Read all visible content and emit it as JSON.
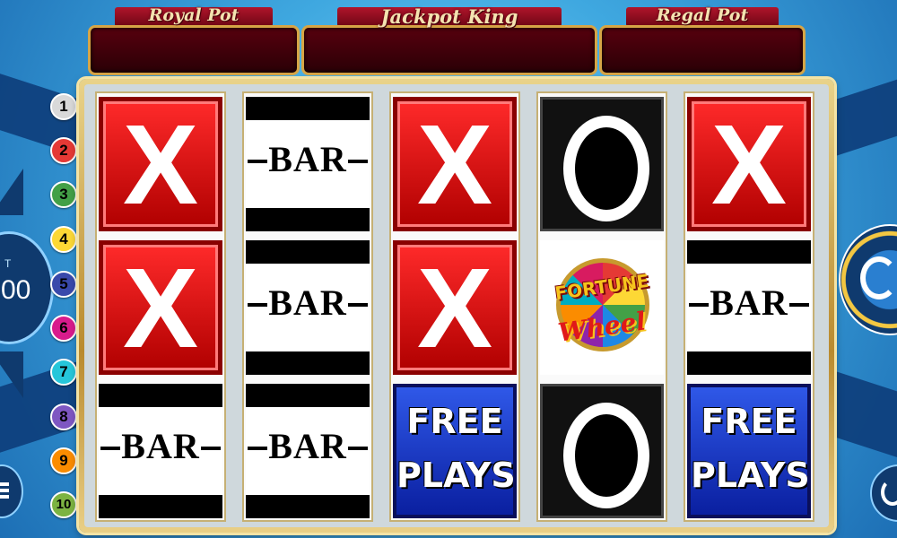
{
  "jackpots": [
    {
      "name": "Royal Pot",
      "value": ""
    },
    {
      "name": "Jackpot King",
      "value": ""
    },
    {
      "name": "Regal Pot",
      "value": ""
    }
  ],
  "paylines": [
    {
      "label": "1",
      "color": "#d9d9d9"
    },
    {
      "label": "2",
      "color": "#e53935"
    },
    {
      "label": "3",
      "color": "#43a047"
    },
    {
      "label": "4",
      "color": "#fdd835"
    },
    {
      "label": "5",
      "color": "#3949ab"
    },
    {
      "label": "6",
      "color": "#d81b8c"
    },
    {
      "label": "7",
      "color": "#26c6da"
    },
    {
      "label": "8",
      "color": "#7e57c2"
    },
    {
      "label": "9",
      "color": "#fb8c00"
    },
    {
      "label": "10",
      "color": "#7cb342"
    }
  ],
  "bet": {
    "label": "T",
    "value": "00"
  },
  "reels": [
    [
      "X",
      "X",
      "BAR"
    ],
    [
      "BAR",
      "BAR",
      "BAR"
    ],
    [
      "X",
      "X",
      "FREE PLAYS"
    ],
    [
      "O",
      "FORTUNE WHEEL",
      "O"
    ],
    [
      "X",
      "BAR",
      "FREE PLAYS"
    ]
  ],
  "symbols": {
    "x": "X",
    "bar": "BAR",
    "free_line1": "FREE",
    "free_line2": "PLAYS",
    "wheel_line1": "FORTUNE",
    "wheel_line2": "Wheel"
  },
  "icons": {
    "menu": "menu-icon",
    "spin": "spin-button",
    "autoplay": "autoplay-icon",
    "bet_up": "bet-up-arrow-icon",
    "bet_down": "bet-down-arrow-icon"
  },
  "colors": {
    "reel_frame": "#d6a546",
    "banner": "#6d0614",
    "x_symbol": "#e00000",
    "free_plays": "#1b3cd0"
  }
}
